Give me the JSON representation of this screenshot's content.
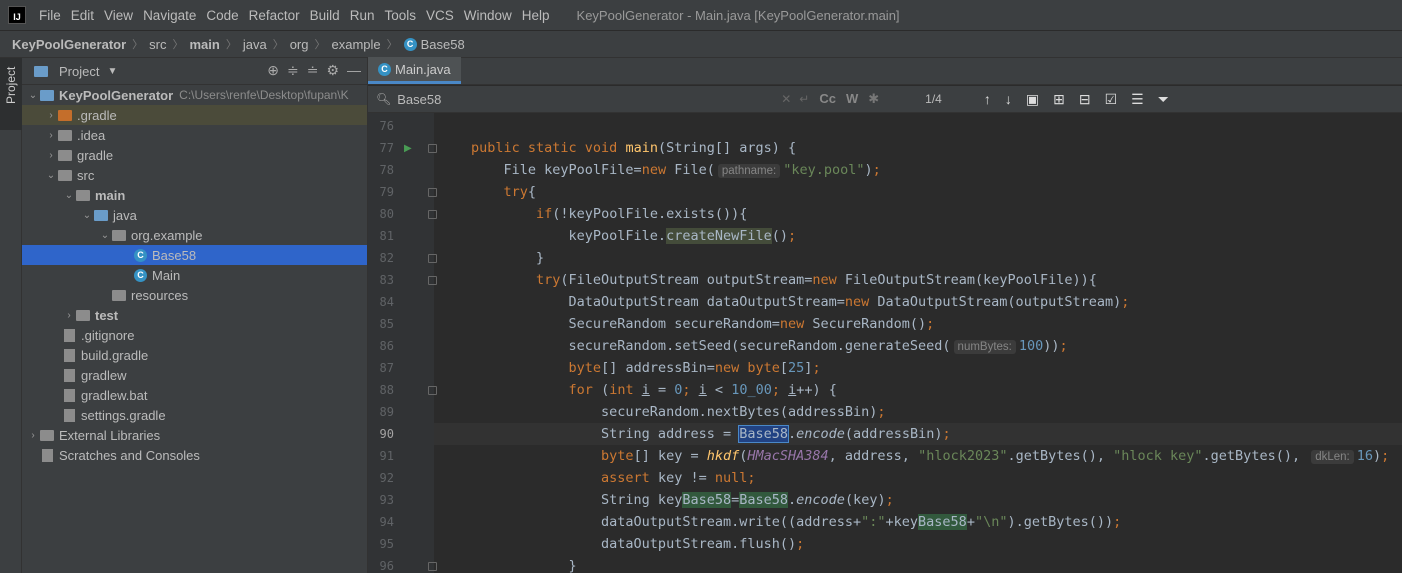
{
  "menubar": {
    "logo": "IJ",
    "items": [
      "File",
      "Edit",
      "View",
      "Navigate",
      "Code",
      "Refactor",
      "Build",
      "Run",
      "Tools",
      "VCS",
      "Window",
      "Help"
    ],
    "title": "KeyPoolGenerator - Main.java [KeyPoolGenerator.main]"
  },
  "breadcrumbs": [
    "KeyPoolGenerator",
    "src",
    "main",
    "java",
    "org",
    "example",
    "Base58"
  ],
  "left_strip": {
    "project_tab": "Project"
  },
  "project_panel": {
    "title": "Project",
    "root_name": "KeyPoolGenerator",
    "root_path": "C:\\Users\\renfe\\Desktop\\fupan\\K",
    "items": [
      ".gradle",
      ".idea",
      "gradle",
      "src",
      "main",
      "java",
      "org.example",
      "Base58",
      "Main",
      "resources",
      "test",
      ".gitignore",
      "build.gradle",
      "gradlew",
      "gradlew.bat",
      "settings.gradle",
      "External Libraries",
      "Scratches and Consoles"
    ]
  },
  "editor": {
    "tab_label": "Main.java",
    "search": {
      "value": "Base58",
      "match_count": "1/4",
      "case_opt": "Cc",
      "word_opt": "W"
    },
    "line_numbers": [
      "76",
      "77",
      "78",
      "79",
      "80",
      "81",
      "82",
      "83",
      "84",
      "85",
      "86",
      "87",
      "88",
      "89",
      "90",
      "91",
      "92",
      "93",
      "94",
      "95",
      "96"
    ],
    "hints": {
      "pathname": "pathname:",
      "numBytes": "numBytes:",
      "dkLen": "dkLen:"
    },
    "colors": {
      "keyword": "#cc7832",
      "string": "#6a8759",
      "number": "#6897bb",
      "method": "#ffc66d",
      "text": "#a9b7c6",
      "selection": "#2f65ca"
    }
  }
}
